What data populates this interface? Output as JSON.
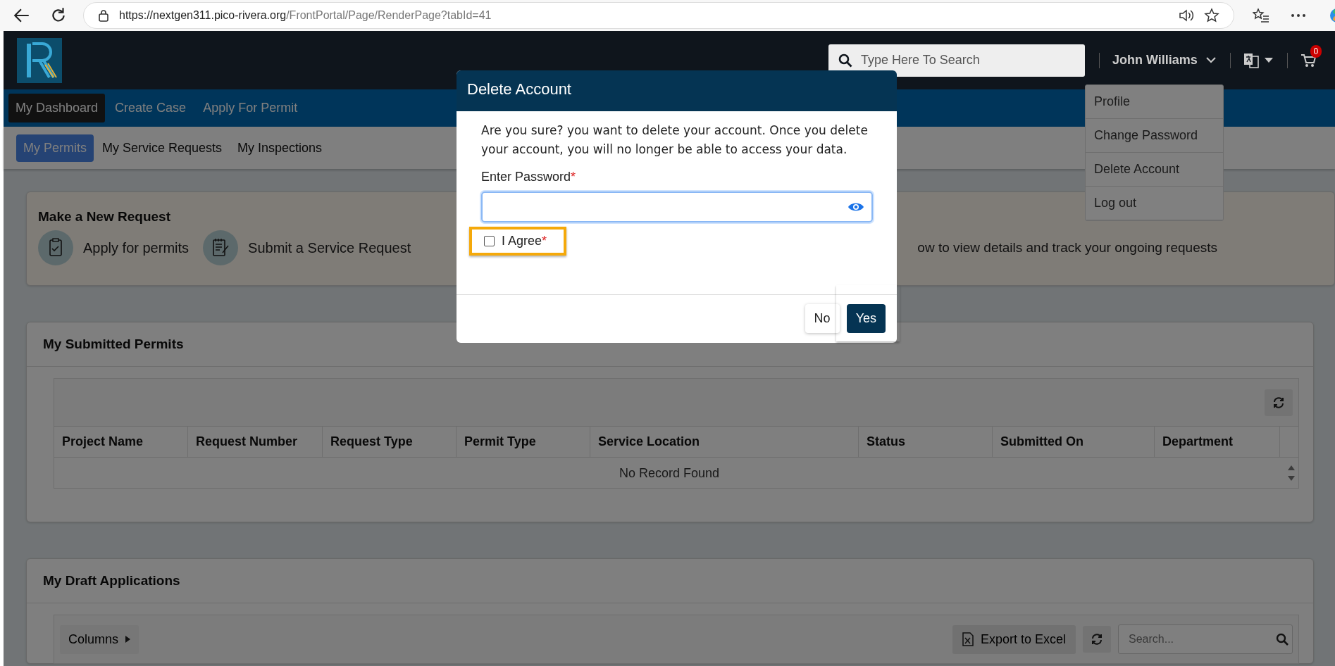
{
  "browser": {
    "url_host": "https://nextgen311.pico-rivera.org",
    "url_path": "/FrontPortal/Page/RenderPage?tabId=41"
  },
  "header": {
    "search_placeholder": "Type Here To Search",
    "user_name": "John Williams",
    "cart_count": "0"
  },
  "user_menu": [
    {
      "label": "Profile"
    },
    {
      "label": "Change Password"
    },
    {
      "label": "Delete Account"
    },
    {
      "label": "Log out"
    }
  ],
  "nav": [
    {
      "label": "My Dashboard",
      "selected": true
    },
    {
      "label": "Create Case",
      "selected": false
    },
    {
      "label": "Apply For Permit",
      "selected": false
    }
  ],
  "subnav": [
    {
      "label": "My Permits",
      "selected": true
    },
    {
      "label": "My Service Requests",
      "selected": false
    },
    {
      "label": "My Inspections",
      "selected": false
    }
  ],
  "new_request": {
    "title": "Make a New Request",
    "actions": [
      {
        "label": "Apply for permits"
      },
      {
        "label": "Submit a Service Request"
      }
    ],
    "hint": "ow to view details and track your ongoing requests"
  },
  "submitted": {
    "title": "My Submitted Permits",
    "columns": [
      "Project Name",
      "Request Number",
      "Request Type",
      "Permit Type",
      "Service Location",
      "Status",
      "Submitted On",
      "Department"
    ],
    "empty_message": "No Record Found"
  },
  "drafts": {
    "title": "My Draft Applications",
    "columns_button": "Columns",
    "export_button": "Export to Excel",
    "search_placeholder": "Search..."
  },
  "dialog": {
    "title": "Delete Account",
    "message": "Are you sure? you want to delete your account. Once you delete your account, you will no longer be able to access your data.",
    "password_label": "Enter Password",
    "password_mark": "*",
    "agree_label": "I Agree",
    "agree_mark": "*",
    "agree_checked": false,
    "agree_highlighted": true,
    "buttons": [
      {
        "label": "No",
        "kind": "secondary",
        "highlighted": false
      },
      {
        "label": "Yes",
        "kind": "primary",
        "highlighted": true
      }
    ]
  }
}
